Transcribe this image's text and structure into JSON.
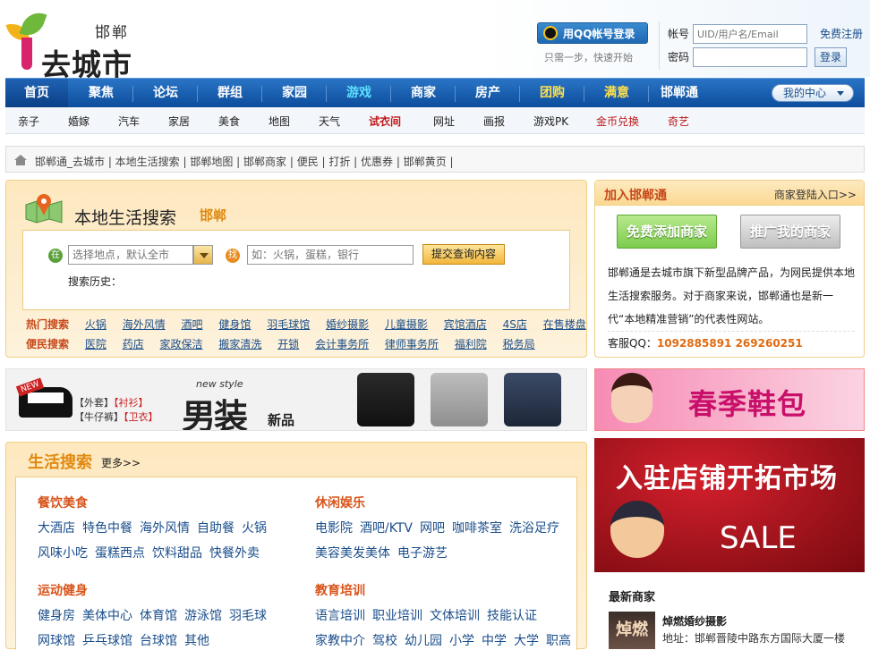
{
  "header": {
    "city": "邯郸",
    "brand": "去城市",
    "qq_login": "用QQ帐号登录",
    "qq_tip": "只需一步，快速开始",
    "account_label": "帐号",
    "account_placeholder": "UID/用户名/Email",
    "password_label": "密码",
    "register": "免费注册",
    "login_button": "登录"
  },
  "mainnav": {
    "items": [
      "首页",
      "聚焦",
      "论坛",
      "群组",
      "家园",
      "游戏",
      "商家",
      "房产",
      "团购",
      "满意",
      "邯郸通"
    ],
    "my_center": "我的中心"
  },
  "subnav": {
    "items": [
      "亲子",
      "婚嫁",
      "汽车",
      "家居",
      "美食",
      "地图",
      "天气",
      "试衣间",
      "网址",
      "画报",
      "游戏PK",
      "金币兑换",
      "奇艺"
    ]
  },
  "breadcrumb": {
    "text": "邯郸通_去城市 | 本地生活搜索 | 邯郸地图 | 邯郸商家 | 便民 | 打折 | 优惠券 | 邯郸黄页 |"
  },
  "search": {
    "title": "本地生活搜索",
    "city": "邯郸",
    "badge_place": "在",
    "badge_find": "找",
    "place_placeholder": "选择地点，默认全市",
    "keyword_placeholder": "如：火锅，蛋糕，银行",
    "submit": "提交查询内容",
    "history_label": "搜索历史：",
    "hot_label": "热门搜索",
    "hot": [
      "火锅",
      "海外风情",
      "酒吧",
      "健身馆",
      "羽毛球馆",
      "婚纱摄影",
      "儿童摄影",
      "宾馆酒店",
      "4S店",
      "在售楼盘"
    ],
    "convenience_label": "便民搜索",
    "convenience": [
      "医院",
      "药店",
      "家政保洁",
      "搬家清洗",
      "开锁",
      "会计事务所",
      "律师事务所",
      "福利院",
      "税务局"
    ]
  },
  "join": {
    "title": "加入邯郸通",
    "merchant_login": "商家登陆入口>>",
    "add_button": "免费添加商家",
    "promo_button": "推广我的商家",
    "desc": "邯郸通是去城市旗下新型品牌产品，为网民提供本地生活搜索服务。对于商家来说，邯郸通也是新一代“本地精准营销”的代表性网站。",
    "qq_label": "客服QQ：",
    "qq_numbers": "1092885891  269260251"
  },
  "banners": {
    "men_tags_1a": "【外套】",
    "men_tags_1b": "【衬衫】",
    "men_tags_2a": "【牛仔裤】",
    "men_tags_2b": "【卫衣】",
    "men_title": "男装",
    "men_new": "新品",
    "men_style": "new style",
    "new_tag": "NEW",
    "shoes_text": "春季鞋包",
    "shop_text": "入驻店铺开拓市场",
    "shop_sale": "SALE"
  },
  "life": {
    "title": "生活搜索",
    "more": "更多>>",
    "food_title": "餐饮美食",
    "food_row1": [
      "大酒店",
      "特色中餐",
      "海外风情",
      "自助餐",
      "火锅"
    ],
    "food_row2": [
      "风味小吃",
      "蛋糕西点",
      "饮料甜品",
      "快餐外卖"
    ],
    "leisure_title": "休闲娱乐",
    "leisure_row1": [
      "电影院",
      "酒吧/KTV",
      "网吧",
      "咖啡茶室",
      "洗浴足疗"
    ],
    "leisure_row2": [
      "美容美发美体",
      "电子游艺"
    ],
    "sport_title": "运动健身",
    "sport_row1": [
      "健身房",
      "美体中心",
      "体育馆",
      "游泳馆",
      "羽毛球"
    ],
    "sport_row2": [
      "网球馆",
      "乒乓球馆",
      "台球馆",
      "其他"
    ],
    "edu_title": "教育培训",
    "edu_row1": [
      "语言培训",
      "职业培训",
      "文体培训",
      "技能认证"
    ],
    "edu_row2": [
      "家教中介",
      "驾校",
      "幼儿园",
      "小学",
      "中学",
      "大学",
      "职高"
    ]
  },
  "new_merchants": {
    "title": "最新商家",
    "logo_text": "焯燃",
    "name": "焯燃婚纱摄影",
    "address": "地址：邯郸晋陵中路东方国际大厦一楼"
  },
  "colors": {
    "nav_blue": "#0c4d9c",
    "accent_orange": "#e08a10",
    "link_blue": "#1a4e8b",
    "panel_bg": "#fde8bf"
  }
}
